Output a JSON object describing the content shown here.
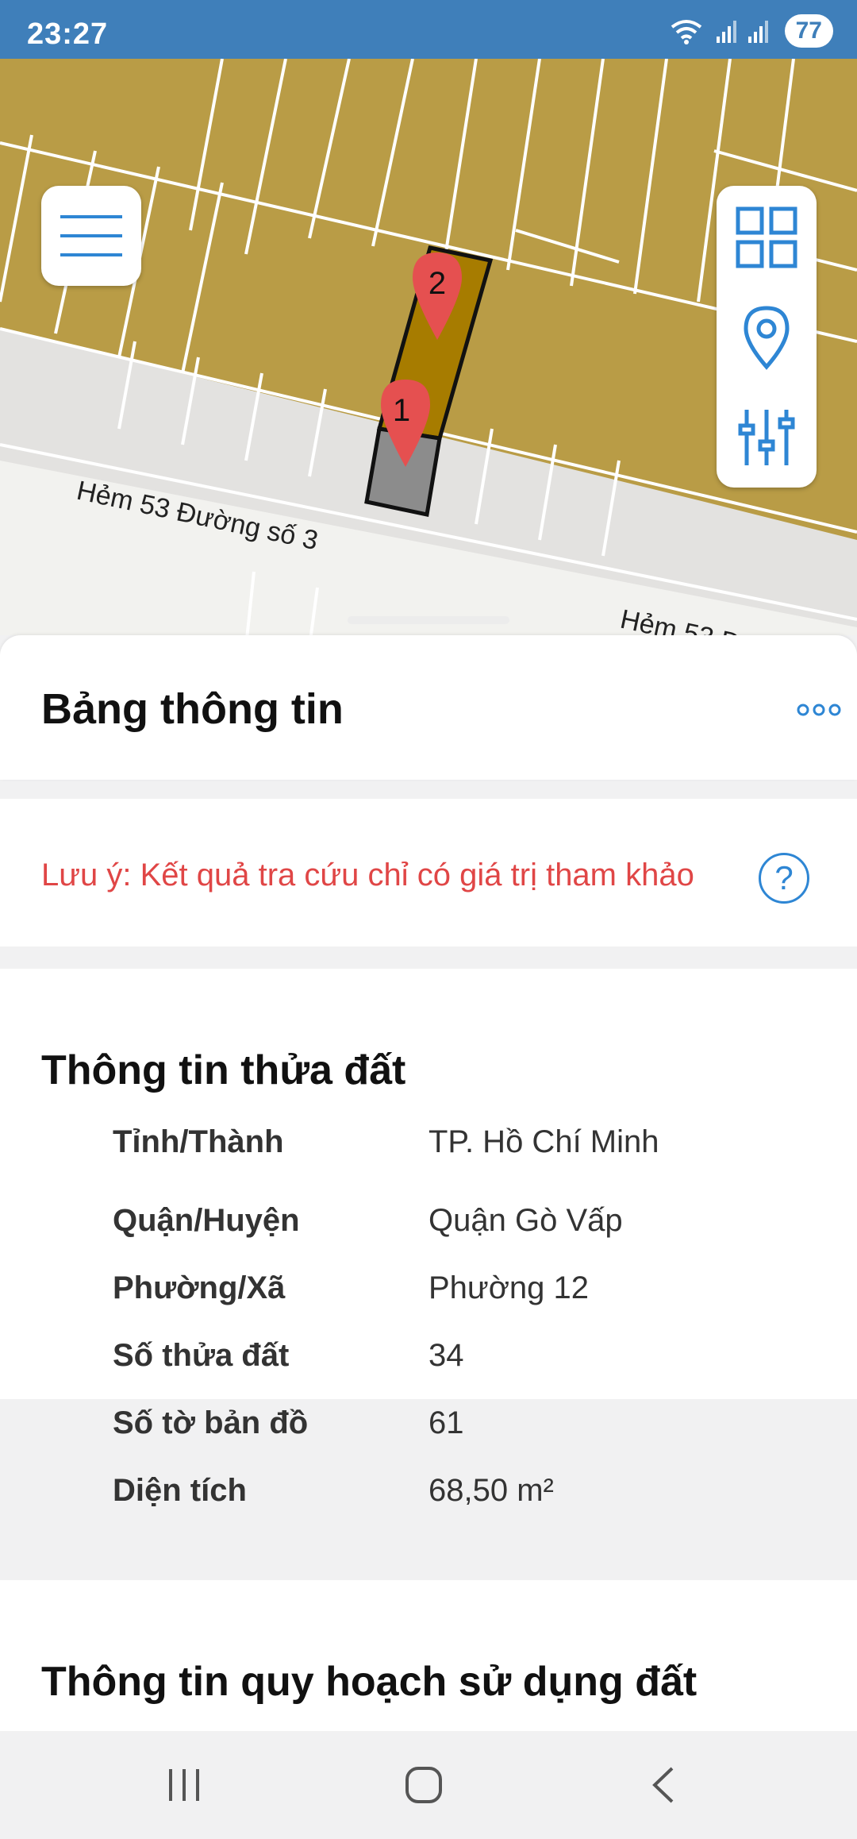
{
  "status": {
    "time": "23:27",
    "battery": "77"
  },
  "map": {
    "road_label_1": "Hẻm 53 Đường số 3",
    "road_label_2": "Hẻm 53 Đ",
    "marker_1": "1",
    "marker_2": "2"
  },
  "panel": {
    "title": "Bảng thông tin"
  },
  "notice": {
    "text": "Lưu ý: Kết quả tra cứu chỉ có giá trị tham khảo",
    "help_symbol": "?"
  },
  "land_info": {
    "title": "Thông tin thửa đất",
    "rows": [
      {
        "label": "Tỉnh/Thành",
        "value": "TP. Hồ Chí Minh"
      },
      {
        "label": "Quận/Huyện",
        "value": "Quận Gò Vấp"
      },
      {
        "label": "Phường/Xã",
        "value": "Phường 12"
      },
      {
        "label": "Số thửa đất",
        "value": "34"
      },
      {
        "label": "Số tờ bản đồ",
        "value": "61"
      },
      {
        "label": "Diện tích",
        "value": "68,50 m²"
      }
    ]
  },
  "planning": {
    "title": "Thông tin quy hoạch sử dụng đất"
  },
  "colors": {
    "status_bar": "#3f7fba",
    "accent": "#2e86d4",
    "notice": "#e04646",
    "parcel": "#b99c46",
    "selected_parcel": "#a77c00"
  },
  "icons": [
    "wifi-icon",
    "signal-icon",
    "battery-icon",
    "menu-icon",
    "grid-icon",
    "location-pin-icon",
    "filter-sliders-icon",
    "more-icon",
    "help-icon",
    "recent-apps-icon",
    "home-icon",
    "back-icon"
  ]
}
